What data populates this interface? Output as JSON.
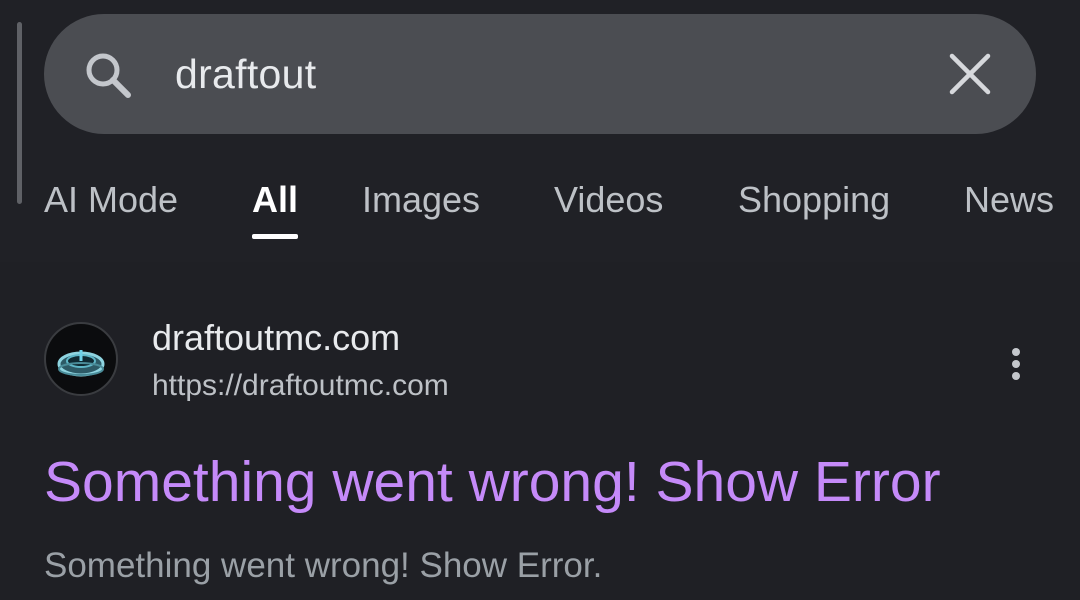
{
  "search": {
    "query": "draftout",
    "search_icon": "search-icon",
    "clear_icon": "close-icon"
  },
  "tabs": [
    {
      "label": "AI Mode",
      "active": false
    },
    {
      "label": "All",
      "active": true
    },
    {
      "label": "Images",
      "active": false
    },
    {
      "label": "Videos",
      "active": false
    },
    {
      "label": "Shopping",
      "active": false
    },
    {
      "label": "News",
      "active": false
    }
  ],
  "result": {
    "site_name": "draftoutmc.com",
    "url": "https://draftoutmc.com",
    "title": "Something went wrong! Show Error",
    "snippet": "Something went wrong! Show Error.",
    "favicon_icon": "portal-ring-icon",
    "more_icon": "more-vert-icon"
  },
  "colors": {
    "background": "#1f2025",
    "search_bar": "#4b4d52",
    "link_visited": "#c58af9",
    "text_primary": "#e8eaed",
    "text_secondary": "#bdc1c6",
    "text_muted": "#9aa0a6"
  }
}
